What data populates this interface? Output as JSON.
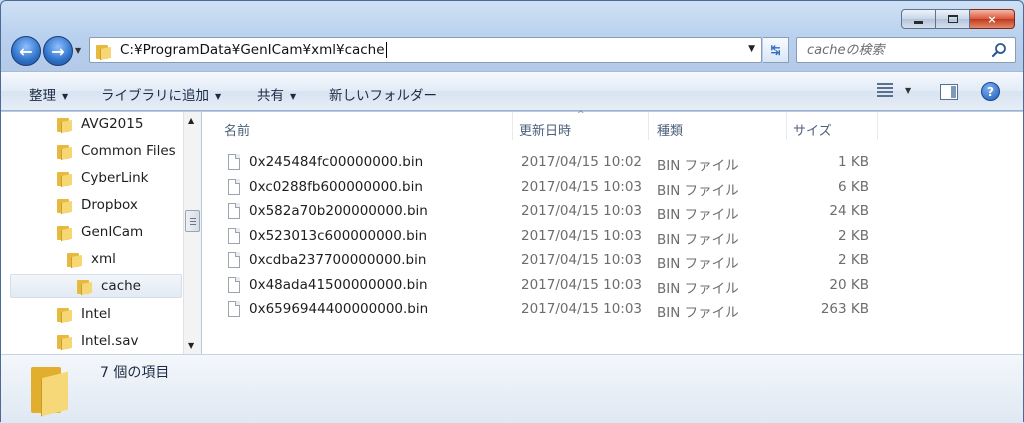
{
  "window": {
    "caption": {
      "minimize": "minimize",
      "maximize": "maximize",
      "close": "×"
    }
  },
  "address": {
    "path": "C:¥ProgramData¥GenICam¥xml¥cache"
  },
  "search": {
    "placeholder": "cacheの検索"
  },
  "toolbar": {
    "organize": "整理",
    "add_to_library": "ライブラリに追加",
    "share": "共有",
    "new_folder": "新しいフォルダー"
  },
  "nav_tree": [
    {
      "label": "AVG2015"
    },
    {
      "label": "Common Files"
    },
    {
      "label": "CyberLink"
    },
    {
      "label": "Dropbox"
    },
    {
      "label": "GenICam"
    },
    {
      "label": "xml"
    },
    {
      "label": "cache",
      "selected": true
    },
    {
      "label": "Intel"
    },
    {
      "label": "Intel.sav"
    }
  ],
  "columns": {
    "name": "名前",
    "date": "更新日時",
    "type": "種類",
    "size": "サイズ"
  },
  "files": [
    {
      "name": "0x245484fc00000000.bin",
      "date": "2017/04/15 10:02",
      "type": "BIN ファイル",
      "size": "1 KB"
    },
    {
      "name": "0xc0288fb600000000.bin",
      "date": "2017/04/15 10:03",
      "type": "BIN ファイル",
      "size": "6 KB"
    },
    {
      "name": "0x582a70b200000000.bin",
      "date": "2017/04/15 10:03",
      "type": "BIN ファイル",
      "size": "24 KB"
    },
    {
      "name": "0x523013c600000000.bin",
      "date": "2017/04/15 10:03",
      "type": "BIN ファイル",
      "size": "2 KB"
    },
    {
      "name": "0xcdba237700000000.bin",
      "date": "2017/04/15 10:03",
      "type": "BIN ファイル",
      "size": "2 KB"
    },
    {
      "name": "0x48ada41500000000.bin",
      "date": "2017/04/15 10:03",
      "type": "BIN ファイル",
      "size": "20 KB"
    },
    {
      "name": "0x6596944400000000.bin",
      "date": "2017/04/15 10:03",
      "type": "BIN ファイル",
      "size": "263 KB"
    }
  ],
  "status": {
    "item_count": "7 個の項目"
  },
  "colors": {
    "accent": "#2f72c9",
    "close_button": "#c2391c",
    "folder": "#e7b93f"
  }
}
